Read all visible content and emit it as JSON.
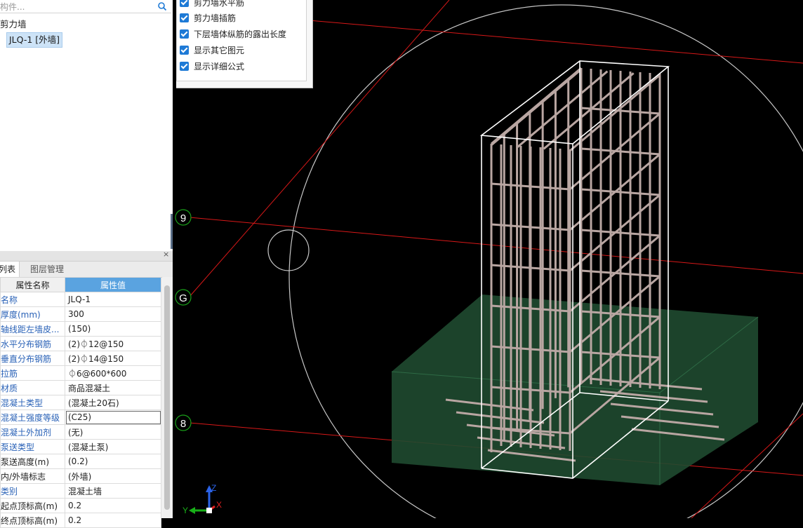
{
  "component_tree": {
    "search_placeholder": "构件...",
    "root_label": "剪力墙",
    "selected_item": "JLQ-1 [外墙]"
  },
  "display_options": [
    {
      "label": "剪力墙水平筋",
      "checked": true
    },
    {
      "label": "剪力墙插筋",
      "checked": true
    },
    {
      "label": "下层墙体纵筋的露出长度",
      "checked": true
    },
    {
      "label": "显示其它图元",
      "checked": true
    },
    {
      "label": "显示详细公式",
      "checked": true
    }
  ],
  "properties_panel": {
    "close_glyph": "×",
    "tabs": [
      "列表",
      "图层管理"
    ],
    "header_name": "属性名称",
    "header_value": "属性值",
    "rows": [
      {
        "name": "名称",
        "value": "JLQ-1"
      },
      {
        "name": "厚度(mm)",
        "value": "300"
      },
      {
        "name": "轴线距左墙皮...",
        "value": "(150)"
      },
      {
        "name": "水平分布钢筋",
        "value": "(2)⏀12@150"
      },
      {
        "name": "垂直分布钢筋",
        "value": "(2)⏀14@150"
      },
      {
        "name": "拉筋",
        "value": "⏀6@600*600"
      },
      {
        "name": "材质",
        "value": "商品混凝土"
      },
      {
        "name": "混凝土类型",
        "value": "(混凝土20石)"
      },
      {
        "name": "混凝土强度等级",
        "value": "(C25)"
      },
      {
        "name": "混凝土外加剂",
        "value": "(无)"
      },
      {
        "name": "泵送类型",
        "value": "(混凝土泵)"
      },
      {
        "name": "泵送高度(m)",
        "value": "(0.2)"
      },
      {
        "name": "内/外墙标志",
        "value": "(外墙)"
      },
      {
        "name": "类别",
        "value": "混凝土墙"
      },
      {
        "name": "起点顶标高(m)",
        "value": "0.2"
      },
      {
        "name": "终点顶标高(m)",
        "value": "0.2"
      }
    ]
  },
  "viewport": {
    "axis_labels": [
      "9",
      "G",
      "8"
    ],
    "gizmo_labels": {
      "x": "X",
      "y": "Y",
      "z": "Z"
    },
    "colors": {
      "grid_line": "#d81818",
      "axis_marker": "#1aa01a",
      "rebar": "#b9a6a2",
      "wall_outline": "#ffffff",
      "footing": "#1f4a30",
      "background": "#000000"
    }
  }
}
